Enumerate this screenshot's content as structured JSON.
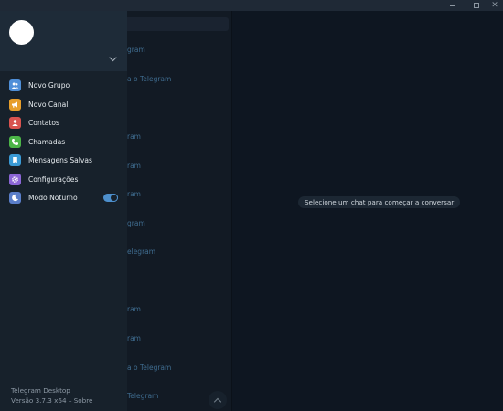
{
  "window": {
    "minimize_glyph": "",
    "maximize_glyph": "",
    "close_glyph": "✕"
  },
  "dialogs": {
    "rows": [
      "gram",
      "a o Telegram",
      "ram",
      "ram",
      "ram",
      "gram",
      "elegram",
      "ram",
      "ram",
      "a o Telegram",
      "Telegram"
    ]
  },
  "chat": {
    "empty_message": "Selecione um chat para começar a conversar"
  },
  "menu": {
    "items": [
      {
        "label": "Novo Grupo",
        "icon": "group-icon",
        "color": "#4f8fd8"
      },
      {
        "label": "Novo Canal",
        "icon": "megaphone-icon",
        "color": "#e79e2b"
      },
      {
        "label": "Contatos",
        "icon": "contact-icon",
        "color": "#d9534f"
      },
      {
        "label": "Chamadas",
        "icon": "phone-icon",
        "color": "#4cb548"
      },
      {
        "label": "Mensagens Salvas",
        "icon": "bookmark-icon",
        "color": "#3a9ad6"
      },
      {
        "label": "Configurações",
        "icon": "gear-icon",
        "color": "#8b66d6"
      },
      {
        "label": "Modo Noturno",
        "icon": "moon-icon",
        "color": "#5a7ec9"
      }
    ],
    "night_mode_on": true,
    "footer_app": "Telegram Desktop",
    "footer_version": "Versão 3.7.3 x64 – Sobre"
  }
}
